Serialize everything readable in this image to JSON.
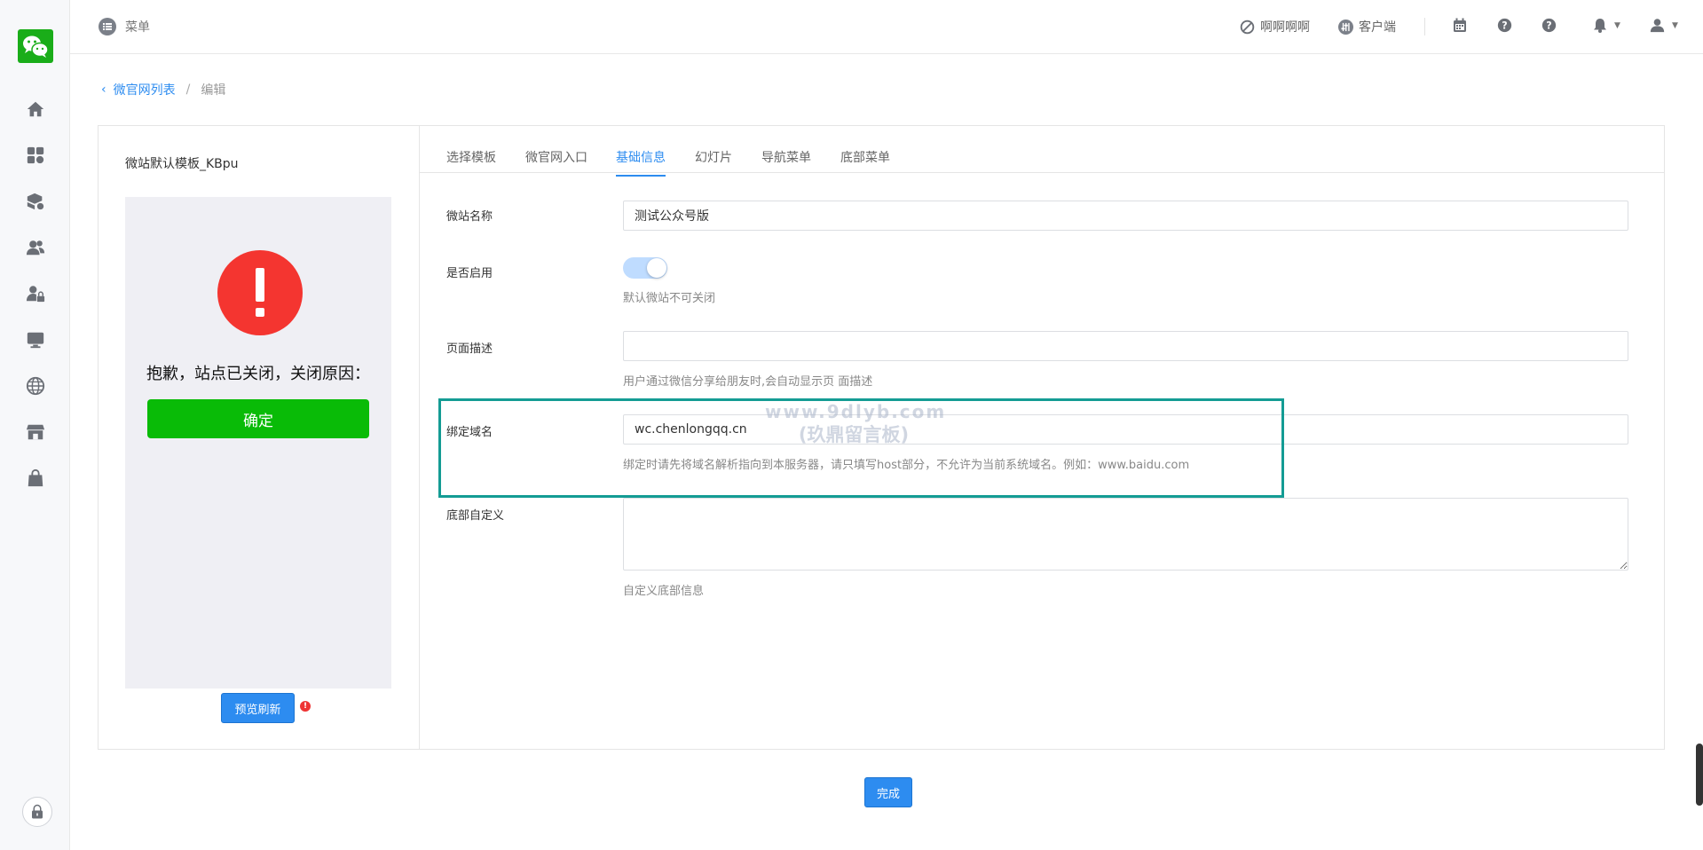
{
  "header": {
    "menu_label": "菜单",
    "item1_label": "啊啊啊啊",
    "item2_label": "客户端"
  },
  "breadcrumb": {
    "parent": "微官网列表",
    "separator": "/",
    "current": "编辑"
  },
  "preview": {
    "template_name": "微站默认模板_KBpu",
    "closed_message": "抱歉，站点已关闭，关闭原因：",
    "confirm_label": "确定",
    "refresh_label": "预览刷新"
  },
  "tabs": [
    {
      "label": "选择模板"
    },
    {
      "label": "微官网入口"
    },
    {
      "label": "基础信息",
      "active": true
    },
    {
      "label": "幻灯片"
    },
    {
      "label": "导航菜单"
    },
    {
      "label": "底部菜单"
    }
  ],
  "form": {
    "site_name": {
      "label": "微站名称",
      "value": "测试公众号版"
    },
    "enabled": {
      "label": "是否启用",
      "on": true,
      "help": "默认微站不可关闭"
    },
    "description": {
      "label": "页面描述",
      "value": "",
      "help": "用户通过微信分享给朋友时,会自动显示页 面描述"
    },
    "domain": {
      "label": "绑定域名",
      "value": "wc.chenlongqq.cn",
      "help": "绑定时请先将域名解析指向到本服务器，请只填写host部分，不允许为当前系统域名。例如：www.baidu.com"
    },
    "footer": {
      "label": "底部自定义",
      "value": "",
      "help": "自定义底部信息"
    }
  },
  "watermark": {
    "line1": "www.9dlyb.com",
    "line2": "(玖鼎留言板)"
  },
  "actions": {
    "done_label": "完成"
  },
  "colors": {
    "primary": "#2d8cf0",
    "confirm_green": "#09bb07",
    "alert_red": "#f43530",
    "highlight": "#149c94"
  }
}
